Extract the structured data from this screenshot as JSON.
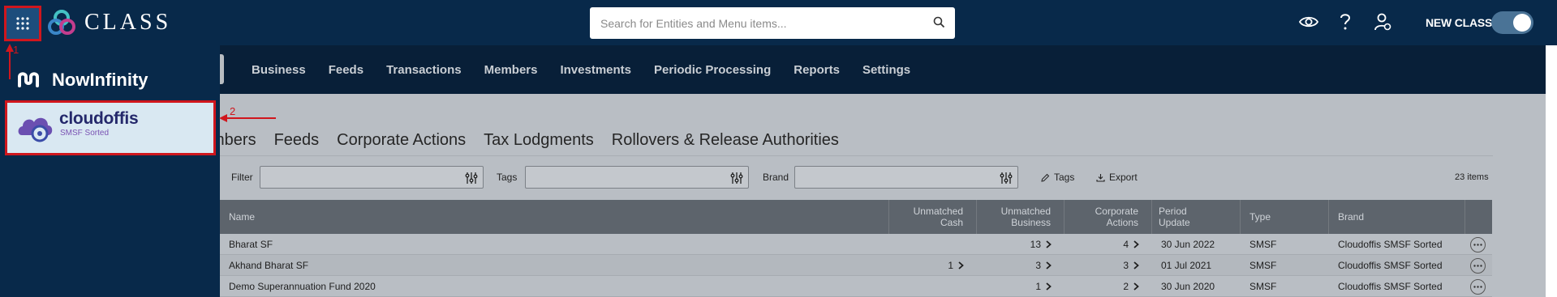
{
  "header": {
    "app_name": "CLASS",
    "search_placeholder": "Search for Entities and Menu items...",
    "new_class_label": "NEW CLASS",
    "new_class_toggle_on": true
  },
  "nav": {
    "items": [
      "Business",
      "Feeds",
      "Transactions",
      "Members",
      "Investments",
      "Periodic Processing",
      "Reports",
      "Settings"
    ]
  },
  "drawer": {
    "nowinfinity_label": "NowInfinity",
    "cloudoffis_name": "cloudoffis",
    "cloudoffis_tagline": "SMSF Sorted"
  },
  "annotations": {
    "marker_1": "1",
    "marker_2": "2"
  },
  "tabs": [
    "mbers",
    "Feeds",
    "Corporate Actions",
    "Tax Lodgments",
    "Rollovers & Release Authorities"
  ],
  "filters": {
    "filter_label": "Filter",
    "tags_label": "Tags",
    "brand_label": "Brand",
    "tags_action": "Tags",
    "export_action": "Export",
    "items_count": "23 items"
  },
  "table": {
    "headers": {
      "name": "Name",
      "unmatched_cash_1": "Unmatched",
      "unmatched_cash_2": "Cash",
      "unmatched_business_1": "Unmatched",
      "unmatched_business_2": "Business",
      "corporate_actions_1": "Corporate",
      "corporate_actions_2": "Actions",
      "period_update_1": "Period",
      "period_update_2": "Update",
      "type": "Type",
      "brand": "Brand"
    },
    "rows": [
      {
        "name": "Bharat SF",
        "unmatched_cash": "",
        "unmatched_business": "13",
        "corporate_actions": "4",
        "period_update": "30 Jun 2022",
        "type": "SMSF",
        "brand": "Cloudoffis SMSF Sorted"
      },
      {
        "name": "Akhand Bharat SF",
        "unmatched_cash": "1",
        "unmatched_business": "3",
        "corporate_actions": "3",
        "period_update": "01 Jul 2021",
        "type": "SMSF",
        "brand": "Cloudoffis SMSF Sorted"
      },
      {
        "name": "Demo Superannuation Fund 2020",
        "unmatched_cash": "",
        "unmatched_business": "1",
        "corporate_actions": "2",
        "period_update": "30 Jun 2020",
        "type": "SMSF",
        "brand": "Cloudoffis SMSF Sorted"
      }
    ]
  },
  "colors": {
    "header_bg": "#08294a",
    "annotation_red": "#d0161d",
    "table_header_bg": "#5d646c"
  }
}
